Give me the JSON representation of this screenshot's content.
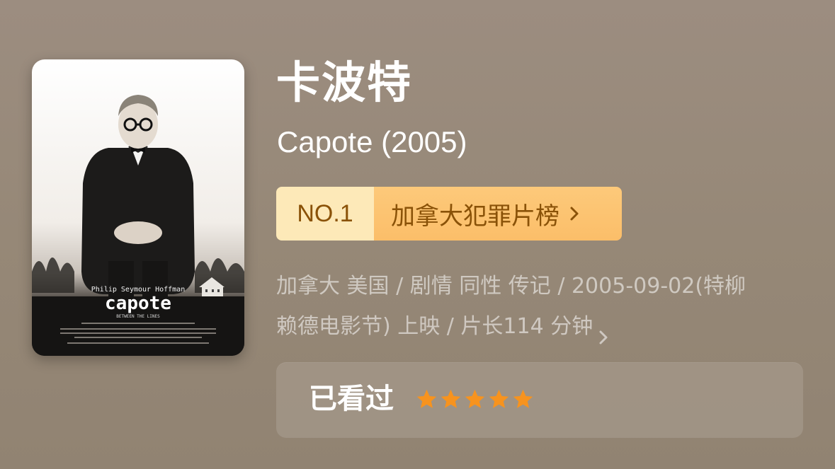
{
  "movie": {
    "title_cn": "卡波特",
    "title_en": "Capote (2005)",
    "poster": {
      "actor": "Philip Seymour Hoffman",
      "title": "capote",
      "tagline": "BETWEEN THE LINES"
    }
  },
  "rank": {
    "number": "NO.1",
    "list_name": "加拿大犯罪片榜",
    "chevron_icon": "chevron-right-icon"
  },
  "meta": {
    "line1": "加拿大 美国 / 剧情 同性 传记 / 2005-09-02(特柳",
    "line2": "赖德电影节) 上映 / 片长114 分钟",
    "chevron_icon": "chevron-right-icon"
  },
  "watched": {
    "label": "已看过",
    "rating": 5,
    "max_rating": 5,
    "star_color": "#f7931e"
  },
  "colors": {
    "background": "#978877",
    "badge_left": "#fde9b8",
    "badge_right": "#fbbe69",
    "badge_text": "#8a5208",
    "meta_text": "rgba(255,255,255,0.55)"
  }
}
